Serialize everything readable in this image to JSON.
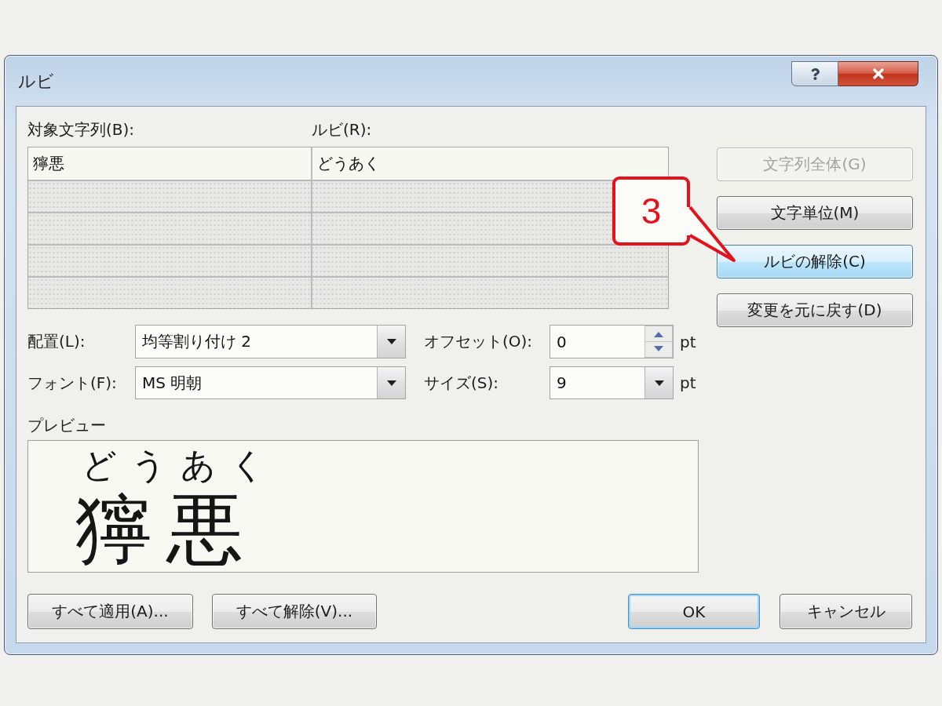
{
  "window": {
    "title": "ルビ"
  },
  "table": {
    "columns": [
      "対象文字列(B):",
      "ルビ(R):"
    ],
    "rows": [
      {
        "cells": [
          "獰悪",
          "どうあく"
        ],
        "disabled": false
      },
      {
        "disabled": true
      },
      {
        "disabled": true
      },
      {
        "disabled": true
      },
      {
        "disabled": true
      }
    ]
  },
  "side_buttons": [
    {
      "label": "文字列全体(G)",
      "disabled": true,
      "highlighted": false
    },
    {
      "label": "文字単位(M)",
      "disabled": false,
      "highlighted": false
    },
    {
      "label": "ルビの解除(C)",
      "disabled": false,
      "highlighted": true
    },
    {
      "label": "変更を元に戻す(D)",
      "disabled": false,
      "highlighted": false
    }
  ],
  "fields": [
    {
      "kind": "dropdown",
      "label": "配置(L):",
      "value": "均等割り付け 2"
    },
    {
      "kind": "spinner",
      "label": "オフセット(O):",
      "value": "0",
      "unit": "pt"
    },
    {
      "kind": "dropdown",
      "label": "フォント(F):",
      "value": "MS 明朝"
    },
    {
      "kind": "dropdown",
      "label": "サイズ(S):",
      "value": "9",
      "unit": "pt"
    }
  ],
  "preview": {
    "label": "プレビュー",
    "ruby": "どうあく",
    "base": "獰悪"
  },
  "callout": {
    "text": "3"
  },
  "footer_buttons": [
    {
      "label": "すべて適用(A)...",
      "default": false
    },
    {
      "label": "すべて解除(V)...",
      "default": false
    },
    {
      "label": "OK",
      "default": true
    },
    {
      "label": "キャンセル",
      "default": false
    }
  ]
}
